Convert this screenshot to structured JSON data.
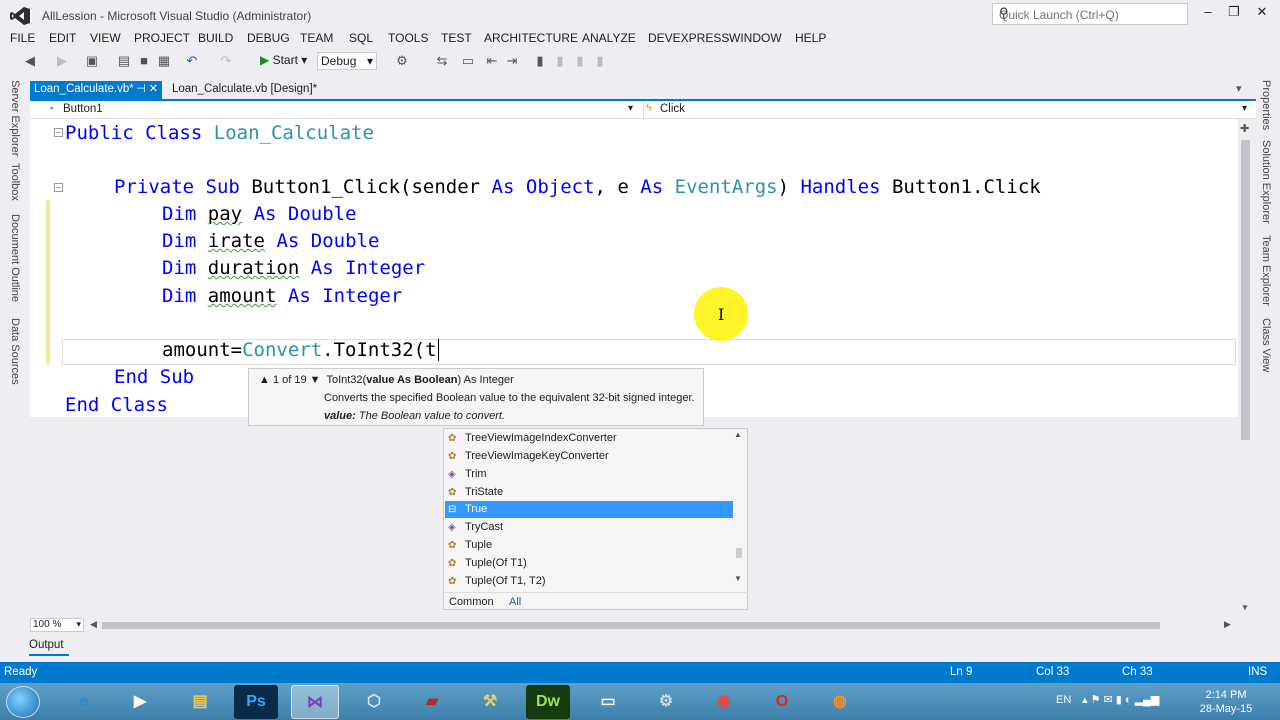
{
  "window": {
    "title": "AllLession - Microsoft Visual Studio (Administrator)",
    "quick_launch_placeholder": "Quick Launch (Ctrl+Q)"
  },
  "menu": [
    "FILE",
    "EDIT",
    "VIEW",
    "PROJECT",
    "BUILD",
    "DEBUG",
    "TEAM",
    "SQL",
    "TOOLS",
    "TEST",
    "ARCHITECTURE",
    "ANALYZE",
    "DEVEXPRESS",
    "WINDOW",
    "HELP"
  ],
  "toolbar": {
    "start_label": "Start",
    "config": "Debug"
  },
  "left_side_tabs": [
    "Server Explorer",
    "Toolbox",
    "Document Outline",
    "Data Sources"
  ],
  "right_side_tabs": [
    "Properties",
    "Solution Explorer",
    "Team Explorer",
    "Class View"
  ],
  "doc_tabs": {
    "active": "Loan_Calculate.vb*",
    "inactive": "Loan_Calculate.vb [Design]*"
  },
  "navbar": {
    "object": "Button1",
    "event": "Click"
  },
  "code": {
    "line1": {
      "kw1": "Public",
      "kw2": "Class",
      "name": "Loan_Calculate"
    },
    "line3": {
      "kw1": "Private",
      "kw2": "Sub",
      "sig1": "Button1_Click(sender ",
      "kw3": "As",
      "ty1": "Object",
      "sig2": ", e ",
      "kw4": "As",
      "ty2": "EventArgs",
      "sig3": ") ",
      "kw5": "Handles",
      "sig4": " Button1.Click"
    },
    "dims": [
      {
        "kw": "Dim",
        "var": "pay",
        "as": "As",
        "type": "Double"
      },
      {
        "kw": "Dim",
        "var": "irate",
        "as": "As",
        "type": "Double"
      },
      {
        "kw": "Dim",
        "var": "duration",
        "as": "As",
        "type": "Integer"
      },
      {
        "kw": "Dim",
        "var": "amount",
        "as": "As",
        "type": "Integer"
      }
    ],
    "assign": {
      "lhs": "amount=",
      "cls": "Convert",
      "rest": ".ToInt32(t"
    },
    "end_sub": {
      "kw1": "End",
      "kw2": "Sub"
    },
    "end_class": {
      "kw1": "End",
      "kw2": "Class"
    }
  },
  "tooltip": {
    "counter": "▲ 1 of 19 ▼",
    "method": "ToInt32(",
    "param": "value As Boolean",
    "returns": ") As Integer",
    "description": "Converts the specified Boolean value to the equivalent 32-bit signed integer.",
    "param_name": "value:",
    "param_desc": "The Boolean value to convert."
  },
  "completion": {
    "items": [
      {
        "label": "TreeViewImageIndexConverter",
        "icon": "class-icon"
      },
      {
        "label": "TreeViewImageKeyConverter",
        "icon": "class-icon"
      },
      {
        "label": "Trim",
        "icon": "method-icon"
      },
      {
        "label": "TriState",
        "icon": "class-icon"
      },
      {
        "label": "True",
        "icon": "keyword-icon"
      },
      {
        "label": "TryCast",
        "icon": "method-icon"
      },
      {
        "label": "Tuple",
        "icon": "class-icon"
      },
      {
        "label": "Tuple(Of T1)",
        "icon": "class-icon"
      },
      {
        "label": "Tuple(Of T1, T2)",
        "icon": "class-icon"
      }
    ],
    "selected": "True",
    "tabs": [
      "Common",
      "All"
    ]
  },
  "zoom": "100 %",
  "output_tab": "Output",
  "status": {
    "text": "Ready",
    "ln": "Ln 9",
    "col": "Col 33",
    "ch": "Ch 33",
    "mode": "INS"
  },
  "tray": {
    "lang": "EN",
    "time": "2:14 PM",
    "date": "28-May-15"
  },
  "colors": {
    "accent": "#007acc",
    "keyword": "#0000ff",
    "type": "#2b91af",
    "selection": "#3399ff"
  }
}
